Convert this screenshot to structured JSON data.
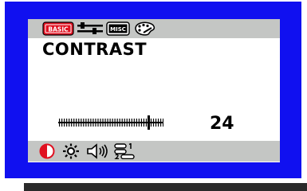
{
  "osd": {
    "title": "CONTRAST",
    "value": "24",
    "slider_level": 0.86,
    "colors": {
      "frame": "#1010f0",
      "bar": "#c4c6c4",
      "accent": "#e01020",
      "text": "#000000"
    },
    "top_menu": [
      {
        "icon": "basic-icon",
        "text": "BASIC",
        "selected": true
      },
      {
        "icon": "advanced-sliders-icon",
        "selected": false
      },
      {
        "icon": "misc-icon",
        "text": "MISC",
        "selected": false
      },
      {
        "icon": "palette-icon",
        "selected": false
      }
    ],
    "sub_menu": [
      {
        "icon": "contrast-icon",
        "selected": true
      },
      {
        "icon": "brightness-icon",
        "selected": false
      },
      {
        "icon": "volume-icon",
        "selected": false
      },
      {
        "icon": "input-select-icon",
        "selected": false
      }
    ]
  }
}
